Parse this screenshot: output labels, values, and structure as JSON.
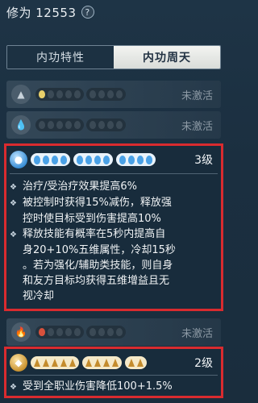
{
  "header": {
    "title": "修为 12553",
    "help_glyph": "?"
  },
  "tabs": [
    {
      "label": "内功特性",
      "active": false
    },
    {
      "label": "内功周天",
      "active": true
    }
  ],
  "rows": [
    {
      "status": "未激活",
      "icon": "mountain-icon",
      "lit_color": "#e8cf6a"
    },
    {
      "status": "未激活",
      "icon": "drop-icon",
      "lit_color": ""
    },
    {
      "status": "未激活",
      "icon": "flame-icon",
      "lit_color": "#d8513c"
    }
  ],
  "card_water": {
    "icon": "water-icon",
    "level": "3级",
    "lines": [
      "治疗/受治疗效果提高6%",
      "被控制时获得15%减伤，释放强",
      "控时使目标受到伤害提高10%",
      "释放技能有概率在5秒内提高自",
      "身20+10%五维属性，冷却15秒",
      "。若为强化/辅助类技能，则自身",
      "和友方目标均获得五维增益且无",
      "视冷却"
    ]
  },
  "card_sun": {
    "icon": "sun-icon",
    "level": "2级",
    "lines": [
      "受到全职业伤害降低100+1.5%"
    ]
  },
  "colors": {
    "highlight_border": "#d92b2f",
    "active_tab": "#eeeeea",
    "accent_blue": "#4aa1e6",
    "accent_gold": "#c48c2d"
  }
}
